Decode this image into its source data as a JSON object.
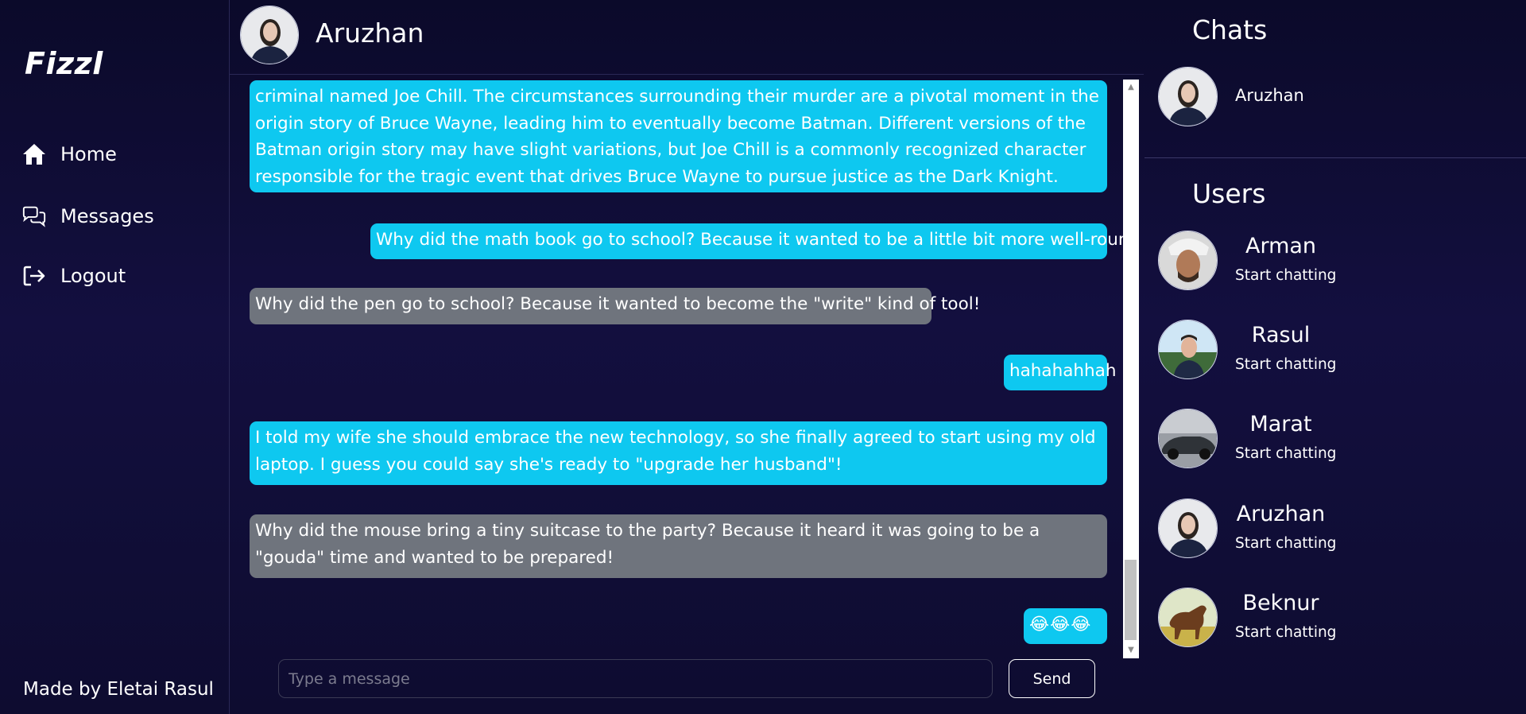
{
  "sidebar": {
    "logo": "Fizzl",
    "nav": [
      {
        "label": "Home",
        "icon": "home-icon"
      },
      {
        "label": "Messages",
        "icon": "chat-bubbles-icon"
      },
      {
        "label": "Logout",
        "icon": "logout-icon"
      }
    ],
    "footer": "Made by Eletai Rasul"
  },
  "chat": {
    "contact_name": "Aruzhan",
    "messages": [
      {
        "sender": "contact",
        "color": "#0ec8f0",
        "text": "criminal named Joe Chill. The circumstances surrounding their murder are a pivotal moment in the origin story of Bruce Wayne, leading him to eventually become Batman. Different versions of the Batman origin story may have slight variations, but Joe Chill is a commonly recognized character responsible for the tragic event that drives Bruce Wayne to pursue justice as the Dark Knight."
      },
      {
        "sender": "me",
        "color": "#0ec8f0",
        "text": "Why did the math book go to school? Because it wanted to be a little bit more well-rounded!"
      },
      {
        "sender": "contact",
        "color": "#6f747d",
        "text": "Why did the pen go to school? Because it wanted to become the \"write\" kind of tool!"
      },
      {
        "sender": "me",
        "color": "#0ec8f0",
        "text": "hahahahhah"
      },
      {
        "sender": "contact",
        "color": "#0ec8f0",
        "text": "I told my wife she should embrace the new technology, so she finally agreed to start using my old laptop. I guess you could say she's ready to \"upgrade her husband\"!"
      },
      {
        "sender": "contact",
        "color": "#6f747d",
        "text": "Why did the mouse bring a tiny suitcase to the party? Because it heard it was going to be a \"gouda\" time and wanted to be prepared!"
      },
      {
        "sender": "me",
        "color": "#0ec8f0",
        "text": "😂😂😂"
      }
    ],
    "input_placeholder": "Type a message",
    "input_value": "",
    "send_label": "Send"
  },
  "right": {
    "chats_title": "Chats",
    "chats": [
      {
        "name": "Aruzhan"
      }
    ],
    "users_title": "Users",
    "users": [
      {
        "name": "Arman",
        "sub": "Start chatting"
      },
      {
        "name": "Rasul",
        "sub": "Start chatting"
      },
      {
        "name": "Marat",
        "sub": "Start chatting"
      },
      {
        "name": "Aruzhan",
        "sub": "Start chatting"
      },
      {
        "name": "Beknur",
        "sub": "Start chatting"
      }
    ]
  }
}
